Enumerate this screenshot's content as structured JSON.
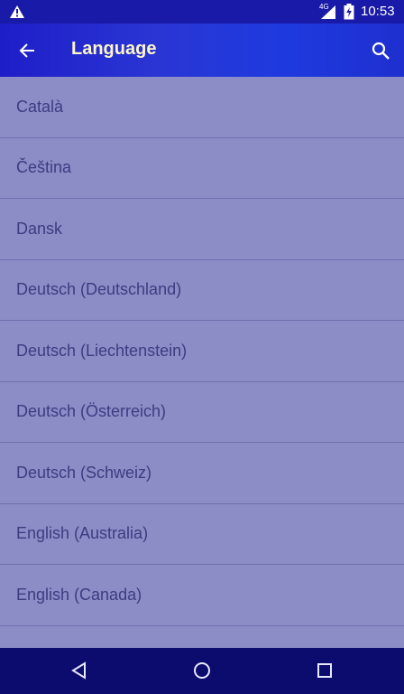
{
  "status_bar": {
    "network_type": "4G",
    "time": "10:53",
    "icons": [
      "warning-icon",
      "signal-icon",
      "battery-icon"
    ]
  },
  "app_bar": {
    "title": "Language",
    "back_icon": "arrow-left-icon",
    "search_icon": "search-icon"
  },
  "languages": [
    "Català",
    "Čeština",
    "Dansk",
    "Deutsch (Deutschland)",
    "Deutsch (Liechtenstein)",
    "Deutsch (Österreich)",
    "Deutsch (Schweiz)",
    "English (Australia)",
    "English (Canada)",
    ""
  ],
  "nav_bar": {
    "icons": [
      "back-triangle-icon",
      "home-circle-icon",
      "recents-square-icon"
    ]
  },
  "colors": {
    "status_bar": "#1a1aa8",
    "app_bar": "#1e1ec8",
    "title_text": "#fdf6c8",
    "list_background": "#8c8cc6",
    "list_text": "#3c3c82",
    "nav_bar": "#0c0c6e"
  }
}
